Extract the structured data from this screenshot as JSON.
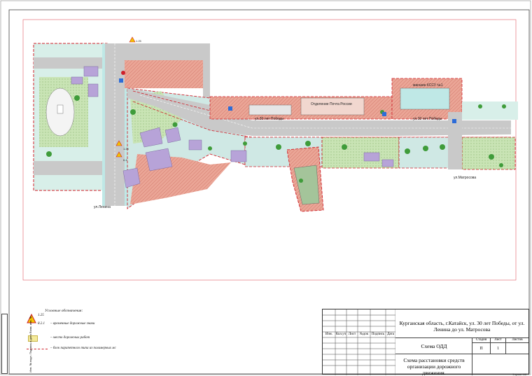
{
  "map": {
    "street_labels": [
      "ул.30 лет Победы",
      "ул.30 лет Победы",
      "ул.Ленина",
      "ул.Матросова",
      "Отделение Почта России",
      "магазин КССУ №1"
    ],
    "small_signs": [
      "1.25",
      "6.4",
      "1.25"
    ]
  },
  "legend": {
    "title": "Условные обозначения:",
    "sign_code_1": "1.25",
    "sign_code_2": "8.2.1",
    "item_1": "– временные дорожные знаки",
    "item_2": "– место дорожных работ",
    "item_3": "– блок парапетного типа из полимерных мс"
  },
  "title_block": {
    "header_cells": [
      "Изм.",
      "Кол.уч",
      "Лист",
      "№док",
      "Подпись",
      "Дата"
    ],
    "project_title": "Курганская область, г.Катайск, ул. 30 лет Победы, от ул. Ленина до ул. Матросова",
    "scheme_name": "Схема ОДД",
    "stage_label": "Стадия",
    "sheet_label": "Лист",
    "sheets_label": "Листов",
    "stage_value": "П",
    "sheet_value": "1",
    "sheets_value": "",
    "description": "Схема расстановки средств организации дорожного движения."
  },
  "side_strip": "Инв. № подл.  Подпись и дата  Взам. инв. №",
  "format": "Формат А3",
  "colors": {
    "road": "#c9c9c9",
    "sidewalk": "#bfe8e6",
    "red_zone": "#e8a898",
    "green_zone": "#c7e3b0",
    "building": "#b7a3d8",
    "work_zone": "#f4ea9a",
    "barrier": "#d0202a"
  }
}
